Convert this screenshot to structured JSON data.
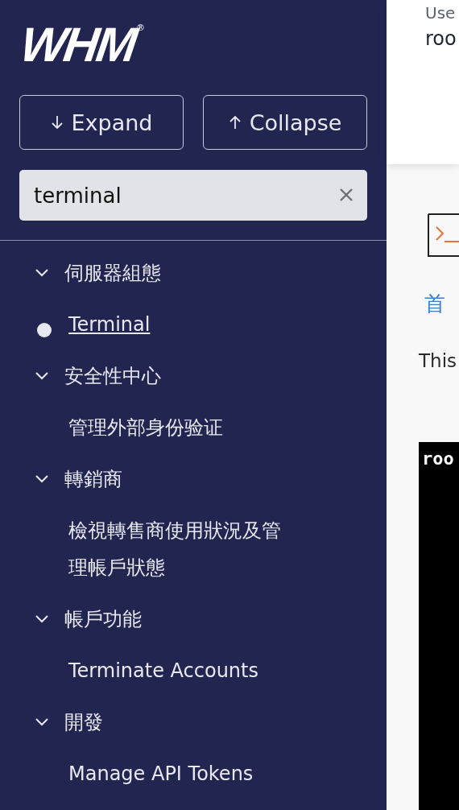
{
  "sidebar": {
    "logo": "WHM",
    "logo_mark": "®",
    "buttons": [
      {
        "kind": "expand",
        "label": "Expand"
      },
      {
        "kind": "collapse",
        "label": "Collapse"
      }
    ],
    "search": {
      "value": "terminal"
    },
    "tree": [
      {
        "label": "伺服器組態",
        "expanded": true,
        "children": [
          {
            "label": "Terminal",
            "selected": true
          }
        ]
      },
      {
        "label": "安全性中心",
        "expanded": true,
        "children": [
          {
            "label": "管理外部身份验证",
            "selected": false
          }
        ]
      },
      {
        "label": "轉銷商",
        "expanded": true,
        "children": [
          {
            "label": "檢視轉售商使用狀況及管理帳戶狀態",
            "selected": false
          }
        ]
      },
      {
        "label": "帳戶功能",
        "expanded": true,
        "children": [
          {
            "label": "Terminate Accounts",
            "selected": false
          }
        ]
      },
      {
        "label": "開發",
        "expanded": true,
        "children": [
          {
            "label": "Manage API Tokens",
            "selected": false
          }
        ]
      }
    ]
  },
  "header": {
    "user_label": "Use",
    "user_name": "roo"
  },
  "content": {
    "breadcrumb": "首",
    "intro": "This",
    "terminal_text": "roo"
  }
}
